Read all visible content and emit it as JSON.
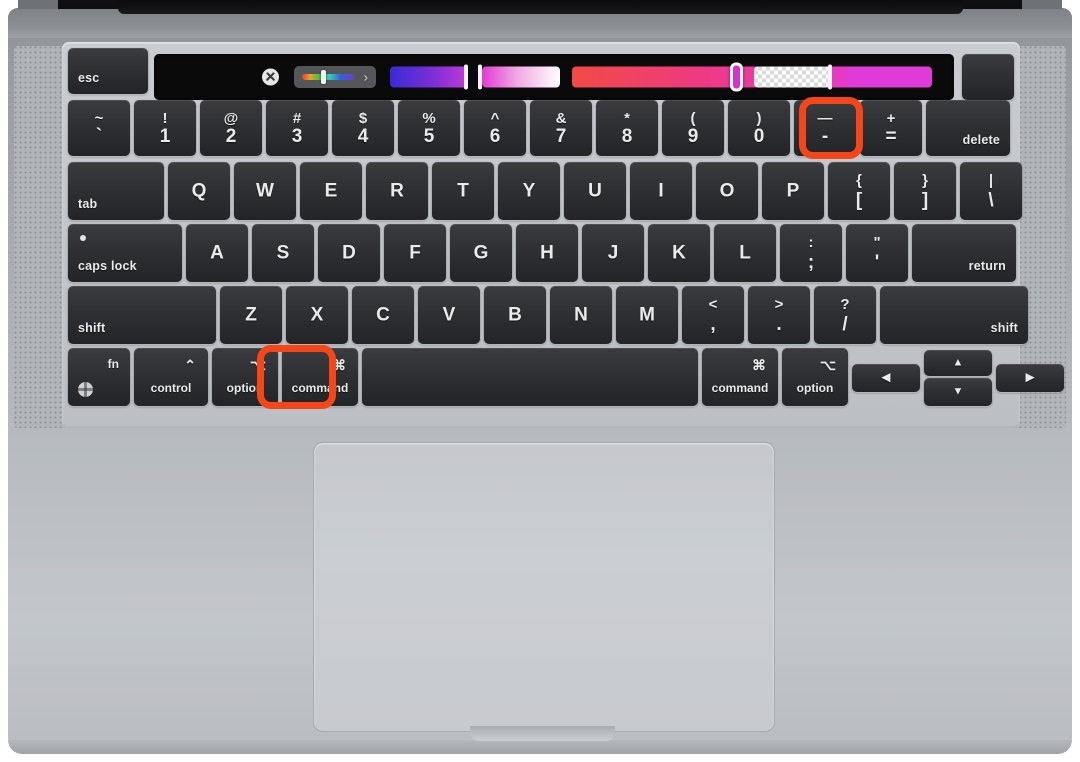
{
  "device": {
    "name": "MacBook Pro keyboard and trackpad",
    "body_color": "#b0b3b7",
    "key_color": "#2f3033",
    "highlight_color": "#f5461a"
  },
  "highlights": [
    {
      "target": "minus-key",
      "label": "minus key highlighted"
    },
    {
      "target": "command-key",
      "label": "command key highlighted"
    }
  ],
  "touchbar": {
    "close_label": "✕",
    "picker_chevron": "›",
    "swatches": [
      {
        "name": "blue-purple-gradient",
        "from": "#3a2ad8",
        "to": "#c13ad8",
        "end_cap": true
      },
      {
        "name": "magenta-white-gradient",
        "from": "#e33ad0",
        "to": "#ffffff",
        "start_cap": true
      },
      {
        "name": "red-magenta-slider",
        "from": "#f14a45",
        "to": "#e23ad8",
        "handle": true
      },
      {
        "name": "transparency-checker",
        "checker": true,
        "end_cap": true
      },
      {
        "name": "solid-magenta",
        "color": "#e23ad8"
      }
    ]
  },
  "keyboard": {
    "rows": [
      {
        "name": "function-row",
        "keys": [
          {
            "name": "esc",
            "type": "wordL",
            "label": "esc"
          },
          {
            "name": "touch-bar",
            "type": "touchbar"
          },
          {
            "name": "touch-id",
            "type": "blank"
          }
        ]
      },
      {
        "name": "number-row",
        "keys": [
          {
            "name": "tilde",
            "type": "dual",
            "top": "~",
            "bot": "`"
          },
          {
            "name": "1",
            "type": "dual",
            "top": "!",
            "bot": "1"
          },
          {
            "name": "2",
            "type": "dual",
            "top": "@",
            "bot": "2"
          },
          {
            "name": "3",
            "type": "dual",
            "top": "#",
            "bot": "3"
          },
          {
            "name": "4",
            "type": "dual",
            "top": "$",
            "bot": "4"
          },
          {
            "name": "5",
            "type": "dual",
            "top": "%",
            "bot": "5"
          },
          {
            "name": "6",
            "type": "dual",
            "top": "^",
            "bot": "6"
          },
          {
            "name": "7",
            "type": "dual",
            "top": "&",
            "bot": "7"
          },
          {
            "name": "8",
            "type": "dual",
            "top": "*",
            "bot": "8"
          },
          {
            "name": "9",
            "type": "dual",
            "top": "(",
            "bot": "9"
          },
          {
            "name": "0",
            "type": "dual",
            "top": ")",
            "bot": "0"
          },
          {
            "name": "minus",
            "type": "dual",
            "top": "—",
            "bot": "-"
          },
          {
            "name": "equals",
            "type": "dual",
            "top": "+",
            "bot": "="
          },
          {
            "name": "delete",
            "type": "wordR",
            "label": "delete"
          }
        ]
      },
      {
        "name": "qwerty-row",
        "keys": [
          {
            "name": "tab",
            "type": "wordL",
            "label": "tab"
          },
          {
            "name": "Q",
            "type": "single",
            "label": "Q"
          },
          {
            "name": "W",
            "type": "single",
            "label": "W"
          },
          {
            "name": "E",
            "type": "single",
            "label": "E"
          },
          {
            "name": "R",
            "type": "single",
            "label": "R"
          },
          {
            "name": "T",
            "type": "single",
            "label": "T"
          },
          {
            "name": "Y",
            "type": "single",
            "label": "Y"
          },
          {
            "name": "U",
            "type": "single",
            "label": "U"
          },
          {
            "name": "I",
            "type": "single",
            "label": "I"
          },
          {
            "name": "O",
            "type": "single",
            "label": "O"
          },
          {
            "name": "P",
            "type": "single",
            "label": "P"
          },
          {
            "name": "bracket-left",
            "type": "dual",
            "top": "{",
            "bot": "["
          },
          {
            "name": "bracket-right",
            "type": "dual",
            "top": "}",
            "bot": "]"
          },
          {
            "name": "backslash",
            "type": "dual",
            "top": "|",
            "bot": "\\"
          }
        ]
      },
      {
        "name": "home-row",
        "keys": [
          {
            "name": "caps-lock",
            "type": "capslock",
            "label": "caps lock"
          },
          {
            "name": "A",
            "type": "single",
            "label": "A"
          },
          {
            "name": "S",
            "type": "single",
            "label": "S"
          },
          {
            "name": "D",
            "type": "single",
            "label": "D"
          },
          {
            "name": "F",
            "type": "single",
            "label": "F"
          },
          {
            "name": "G",
            "type": "single",
            "label": "G"
          },
          {
            "name": "H",
            "type": "single",
            "label": "H"
          },
          {
            "name": "J",
            "type": "single",
            "label": "J"
          },
          {
            "name": "K",
            "type": "single",
            "label": "K"
          },
          {
            "name": "L",
            "type": "single",
            "label": "L"
          },
          {
            "name": "semicolon",
            "type": "dual",
            "top": ":",
            "bot": ";"
          },
          {
            "name": "quote",
            "type": "dual",
            "top": "\"",
            "bot": "'"
          },
          {
            "name": "return",
            "type": "wordR",
            "label": "return"
          }
        ]
      },
      {
        "name": "shift-row",
        "keys": [
          {
            "name": "shift-left",
            "type": "wordL",
            "label": "shift"
          },
          {
            "name": "Z",
            "type": "single",
            "label": "Z"
          },
          {
            "name": "X",
            "type": "single",
            "label": "X"
          },
          {
            "name": "C",
            "type": "single",
            "label": "C"
          },
          {
            "name": "V",
            "type": "single",
            "label": "V"
          },
          {
            "name": "B",
            "type": "single",
            "label": "B"
          },
          {
            "name": "N",
            "type": "single",
            "label": "N"
          },
          {
            "name": "M",
            "type": "single",
            "label": "M"
          },
          {
            "name": "comma",
            "type": "dual",
            "top": "<",
            "bot": ","
          },
          {
            "name": "period",
            "type": "dual",
            "top": ">",
            "bot": "."
          },
          {
            "name": "slash",
            "type": "dual",
            "top": "?",
            "bot": "/"
          },
          {
            "name": "shift-right",
            "type": "wordR",
            "label": "shift"
          }
        ]
      },
      {
        "name": "modifier-row",
        "keys": [
          {
            "name": "fn",
            "type": "fn",
            "label": "fn",
            "icon": "globe-icon"
          },
          {
            "name": "control",
            "type": "mod",
            "symbol": "⌃",
            "label": "control"
          },
          {
            "name": "option-left",
            "type": "mod",
            "symbol": "⌥",
            "label": "option"
          },
          {
            "name": "command-left",
            "type": "mod",
            "symbol": "⌘",
            "label": "command"
          },
          {
            "name": "space",
            "type": "blank",
            "label": ""
          },
          {
            "name": "command-right",
            "type": "mod",
            "symbol": "⌘",
            "label": "command"
          },
          {
            "name": "option-right",
            "type": "mod",
            "symbol": "⌥",
            "label": "option"
          },
          {
            "name": "arrow-left",
            "type": "arrow",
            "label": "◀"
          },
          {
            "name": "arrow-up",
            "type": "arrow",
            "label": "▲"
          },
          {
            "name": "arrow-down",
            "type": "arrow",
            "label": "▼"
          },
          {
            "name": "arrow-right",
            "type": "arrow",
            "label": "▶"
          }
        ]
      }
    ]
  },
  "trackpad": {
    "name": "trackpad"
  }
}
